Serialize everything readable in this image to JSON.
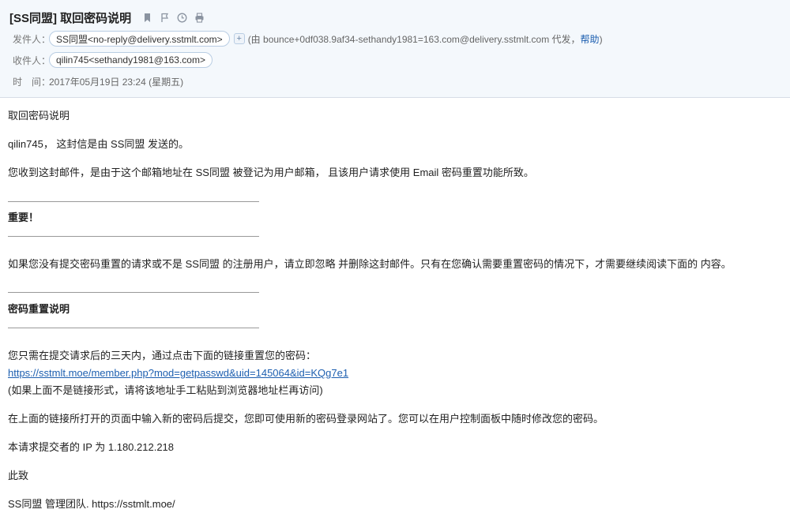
{
  "header": {
    "subject": "[SS同盟] 取回密码说明",
    "icons": [
      "bookmark-icon",
      "flag-icon",
      "clock-icon",
      "print-icon"
    ],
    "sender_label": "发件人：",
    "sender": "SS同盟<no-reply@delivery.sstmlt.com>",
    "add_symbol": "+",
    "proxy_prefix": "(由 bounce+0df038.9af34-sethandy1981=163.com@delivery.sstmlt.com 代发，",
    "proxy_help": "帮助",
    "proxy_suffix": ")",
    "recipient_label": "收件人：",
    "recipient": "qilin745<sethandy1981@163.com>",
    "time_label": "时　间：",
    "time_value": "2017年05月19日 23:24 (星期五)"
  },
  "body": {
    "title": "取回密码说明",
    "greeting": "qilin745，  这封信是由 SS同盟 发送的。",
    "reason": "您收到这封邮件，是由于这个邮箱地址在 SS同盟 被登记为用户邮箱， 且该用户请求使用 Email 密码重置功能所致。",
    "important_heading": "重要！",
    "important_text": "如果您没有提交密码重置的请求或不是 SS同盟 的注册用户，请立即忽略 并删除这封邮件。只有在您确认需要重置密码的情况下，才需要继续阅读下面的 内容。",
    "reset_heading": "密码重置说明",
    "reset_instruction": "您只需在提交请求后的三天内，通过点击下面的链接重置您的密码：",
    "reset_link": "https://sstmlt.moe/member.php?mod=getpasswd&uid=145064&id=KQg7e1",
    "link_note": "(如果上面不是链接形式，请将该地址手工粘贴到浏览器地址栏再访问)",
    "after_text": "在上面的链接所打开的页面中输入新的密码后提交，您即可使用新的密码登录网站了。您可以在用户控制面板中随时修改您的密码。",
    "ip_text": "本请求提交者的 IP 为 1.180.212.218",
    "closing": "此致",
    "signature": "SS同盟 管理团队. https://sstmlt.moe/"
  },
  "colors": {
    "header_bg": "#f4f8fc",
    "link": "#1d5fb0",
    "pill_border": "#b9cde3"
  }
}
